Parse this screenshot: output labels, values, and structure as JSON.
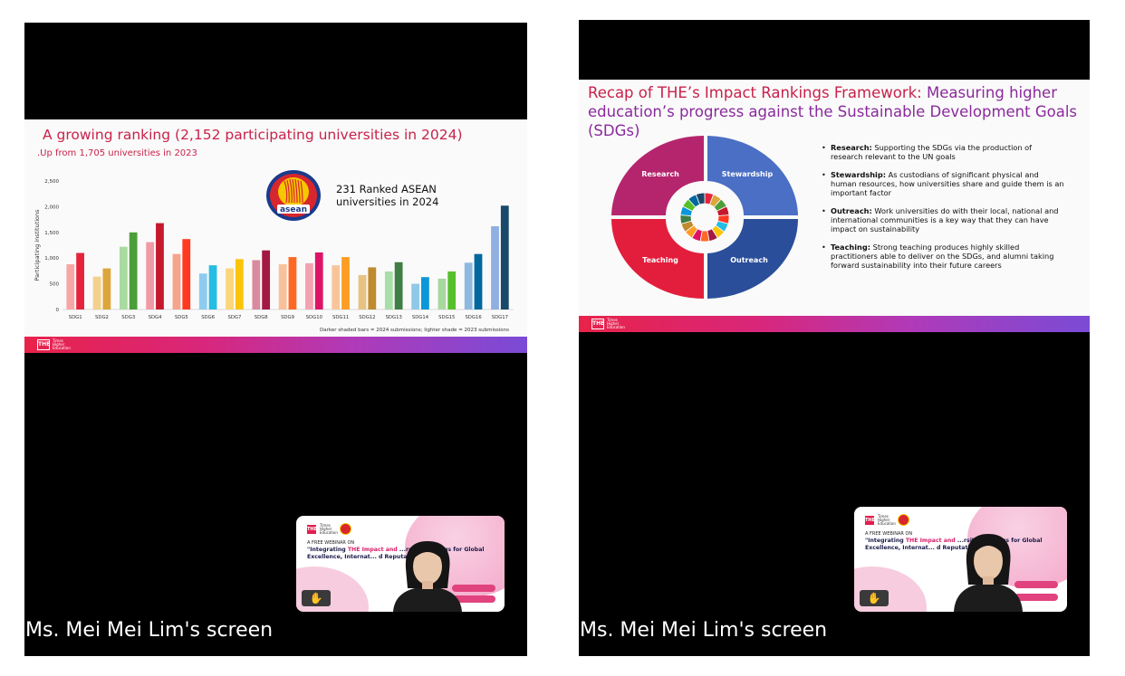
{
  "left": {
    "slide": {
      "title": "A growing ranking (2,152 participating universities in 2024)",
      "subtitle": ".Up from 1,705 universities in 2023",
      "asean_logo_text": "asean",
      "asean_callout": "231 Ranked ASEAN universities in 2024",
      "note": "Darker shaded bars = 2024 submissions; lighter shade = 2023 submissions",
      "footer_logo": {
        "box": "THE",
        "text": "Times Higher Education"
      }
    },
    "screen_label": "Ms. Mei Mei Lim's screen",
    "video": {
      "logo_box": "THE",
      "logo_text": "Times Higher Education",
      "line1": "A FREE WEBINAR ON",
      "line2a": "\"Integrating ",
      "line2b": "THE Impact and",
      "line2c": " ...rsity Rankings for Global Excellence, Internat... d Reputation\"",
      "hand_icon": "raise-hand-icon"
    }
  },
  "right": {
    "slide": {
      "title_part1": "Recap of THE’s Impact Rankings Framework: ",
      "title_part2": "Measuring higher education’s progress against the Sustainable Development Goals (SDGs)",
      "wheel": {
        "research": "Research",
        "stewardship": "Stewardship",
        "teaching": "Teaching",
        "outreach": "Outreach",
        "colors": {
          "research": "#b5256d",
          "stewardship": "#4a6fc4",
          "teaching": "#e31e3c",
          "outreach": "#2a4e9a"
        }
      },
      "bullets": [
        {
          "term": "Research:",
          "text": " Supporting the SDGs via the production of research relevant to the UN goals"
        },
        {
          "term": "Stewardship:",
          "text": " As custodians of significant physical and human resources, how universities share and guide them is an important factor"
        },
        {
          "term": "Outreach:",
          "text": " Work universities do with their local, national and international communities is a key way that they can have impact on sustainability"
        },
        {
          "term": "Teaching:",
          "text": " Strong teaching produces highly skilled practitioners able to deliver on the SDGs, and alumni taking forward sustainability into their future careers"
        }
      ],
      "footer_logo": {
        "box": "THE",
        "text": "Times Higher Education"
      }
    },
    "screen_label": "Ms. Mei Mei Lim's screen",
    "video": {
      "logo_box": "THE",
      "logo_text": "Times Higher Education",
      "line1": "A FREE WEBINAR ON",
      "line2a": "\"Integrating ",
      "line2b": "THE Impact and",
      "line2c": " ...rsity Rankings for Global Excellence, Internat... d Reputation\"",
      "hand_icon": "raise-hand-icon"
    }
  },
  "chart_data": {
    "type": "bar",
    "title": "A growing ranking (2,152 participating universities in 2024)",
    "ylabel": "Participating institutions",
    "xlabel": "",
    "ylim": [
      0,
      2500
    ],
    "yticks": [
      "0",
      "500",
      "1,000",
      "1,500",
      "2,000",
      "2,500"
    ],
    "categories": [
      "SDG1",
      "SDG2",
      "SDG3",
      "SDG4",
      "SDG5",
      "SDG6",
      "SDG7",
      "SDG8",
      "SDG9",
      "SDG10",
      "SDG11",
      "SDG12",
      "SDG13",
      "SDG14",
      "SDG15",
      "SDG16",
      "SDG17"
    ],
    "series": [
      {
        "values": [
          880,
          640,
          1220,
          1310,
          1080,
          700,
          800,
          960,
          880,
          900,
          860,
          670,
          740,
          500,
          600,
          910,
          1620
        ]
      },
      {
        "values": [
          1100,
          800,
          1500,
          1680,
          1370,
          860,
          980,
          1150,
          1020,
          1110,
          1020,
          820,
          920,
          630,
          740,
          1080,
          2020
        ]
      }
    ],
    "colors_2023": [
      "#f7a6a6",
      "#f3d08c",
      "#a8dba0",
      "#f19aa6",
      "#f6a48c",
      "#8fcbef",
      "#fbd67a",
      "#d88aa0",
      "#f9c19a",
      "#f5a2b0",
      "#f8c59a",
      "#e8c280",
      "#a8dfa8",
      "#8ec9e8",
      "#a8d8a0",
      "#8fb8e0",
      "#8fb0e0"
    ],
    "colors_2024": [
      "#e5243b",
      "#dda63a",
      "#4c9f38",
      "#c5192d",
      "#ff3a21",
      "#26bde2",
      "#fcc30b",
      "#a21942",
      "#fd6925",
      "#dd1367",
      "#fd9d24",
      "#bf8b2e",
      "#3f7e44",
      "#0a97d9",
      "#56c02b",
      "#00689d",
      "#19486a"
    ],
    "legend": "none"
  }
}
